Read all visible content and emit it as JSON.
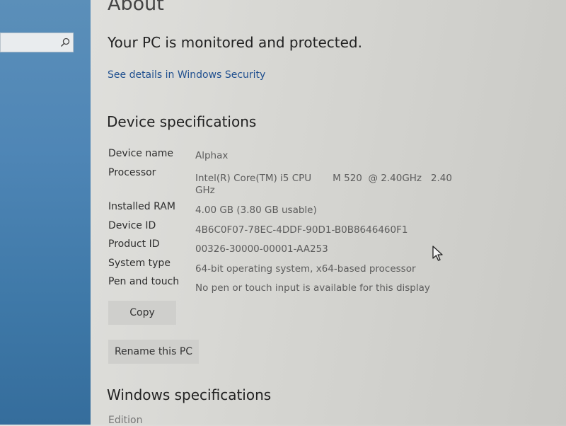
{
  "header": {
    "title": "About",
    "protection_status": "Your PC is monitored and protected.",
    "security_link": "See details in Windows Security"
  },
  "search": {
    "placeholder": ""
  },
  "device_specs": {
    "heading": "Device specifications",
    "rows": [
      {
        "label": "Device name",
        "value": "Alphax"
      },
      {
        "label": "Processor",
        "value": "Intel(R) Core(TM) i5 CPU       M 520  @ 2.40GHz   2.40",
        "value_cont": "GHz"
      },
      {
        "label": "Installed RAM",
        "value": "4.00 GB (3.80 GB usable)"
      },
      {
        "label": "Device ID",
        "value": "4B6C0F07-78EC-4DDF-90D1-B0B8646460F1"
      },
      {
        "label": "Product ID",
        "value": "00326-30000-00001-AA253"
      },
      {
        "label": "System type",
        "value": "64-bit operating system, x64-based processor"
      },
      {
        "label": "Pen and touch",
        "value": "No pen or touch input is available for this display"
      }
    ],
    "copy_button": "Copy",
    "rename_button": "Rename this PC"
  },
  "windows_specs": {
    "heading": "Windows specifications",
    "first_label": "Edition"
  },
  "colors": {
    "sidebar": "#4f86b6",
    "link": "#1f4f8f",
    "background": "#d9d9d5"
  },
  "icons": {
    "search": "search-icon",
    "cursor": "mouse-pointer-icon"
  }
}
